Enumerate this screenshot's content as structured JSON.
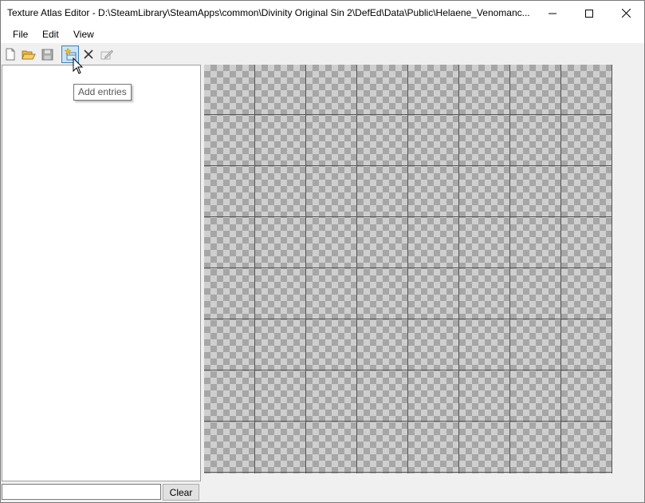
{
  "window": {
    "title": "Texture Atlas Editor - D:\\SteamLibrary\\SteamApps\\common\\Divinity Original Sin 2\\DefEd\\Data\\Public\\Helaene_Venomanc..."
  },
  "menu": {
    "items": [
      {
        "label": "File"
      },
      {
        "label": "Edit"
      },
      {
        "label": "View"
      }
    ]
  },
  "toolbar": {
    "buttons": [
      {
        "icon": "new-file-icon"
      },
      {
        "icon": "open-folder-icon"
      },
      {
        "icon": "save-disk-icon"
      },
      {
        "icon": "add-entries-icon",
        "tooltip": "Add entries"
      },
      {
        "icon": "delete-x-icon"
      },
      {
        "icon": "edit-entry-icon"
      }
    ]
  },
  "tooltip": {
    "text": "Add entries"
  },
  "filter": {
    "value": "",
    "placeholder": ""
  },
  "clear_button": {
    "label": "Clear"
  },
  "colors": {
    "accent": "#3c7fb1",
    "checker_dark": "#a6a6a6",
    "checker_light": "#cfcfcf",
    "grid_line": "#555555"
  }
}
